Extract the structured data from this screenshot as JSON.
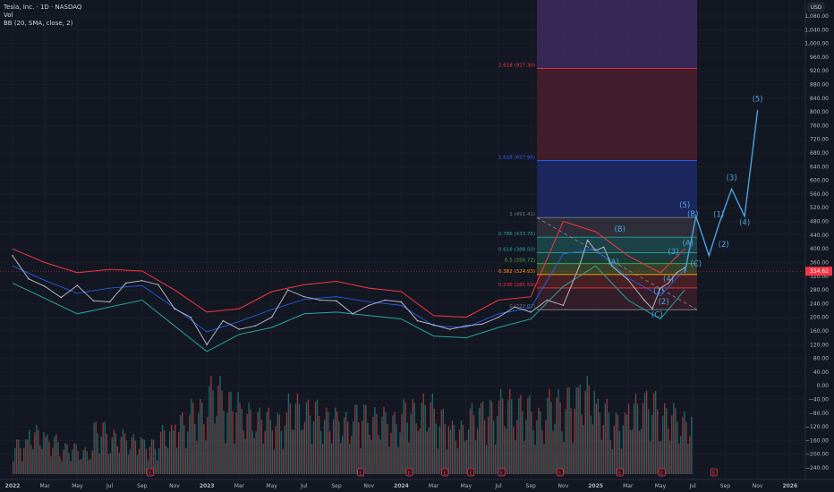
{
  "header": {
    "symbol_line": "Tesla, Inc. · 1D · NASDAQ",
    "vol_label": "Vol",
    "bb_label": "BB (20, SMA, close, 2)"
  },
  "currency_badge": "USD",
  "price_badge": "334.62",
  "colors": {
    "background": "#131722",
    "grid": "#1e222d",
    "price": "#b2b5be",
    "bb_upper": "#f23645",
    "bb_lower": "#26a69a",
    "bb_basis": "#2962ff",
    "wave": "#4aa3df",
    "vol_up": "#26a69a",
    "vol_down": "#ef5350"
  },
  "chart_data": {
    "type": "line",
    "title": "Tesla, Inc. · 1D · NASDAQ",
    "y_axis": {
      "ticks": [
        1080,
        1040,
        1000,
        960,
        920,
        880,
        840,
        800,
        760,
        720,
        680,
        640,
        600,
        560,
        520,
        480,
        440,
        400,
        360,
        320,
        280,
        240,
        200,
        160,
        120,
        80,
        40,
        0,
        -40,
        -80,
        -120,
        -160,
        -200,
        -240
      ],
      "tick_labels": [
        "1,080.00",
        "1,040.00",
        "1,000.00",
        "960.00",
        "920.00",
        "880.00",
        "840.00",
        "800.00",
        "760.00",
        "720.00",
        "680.00",
        "640.00",
        "600.00",
        "560.00",
        "520.00",
        "480.00",
        "440.00",
        "400.00",
        "360.00",
        "320.00",
        "280.00",
        "240.00",
        "200.00",
        "160.00",
        "120.00",
        "80.00",
        "40.00",
        "0.00",
        "−40.00",
        "−80.00",
        "−120.00",
        "−160.00",
        "−200.00",
        "−240.00"
      ]
    },
    "x_axis": {
      "ticks": [
        "2022",
        "Mar",
        "May",
        "Jul",
        "Sep",
        "Nov",
        "2023",
        "Mar",
        "May",
        "Jul",
        "Sep",
        "Nov",
        "2024",
        "Mar",
        "May",
        "Jul",
        "Sep",
        "Nov",
        "2025",
        "Mar",
        "May",
        "Jul",
        "Sep",
        "Nov",
        "2026"
      ],
      "tick_months": [
        0,
        2,
        4,
        6,
        8,
        10,
        12,
        14,
        16,
        18,
        20,
        22,
        24,
        26,
        28,
        30,
        32,
        34,
        36,
        38,
        40,
        42,
        44,
        46,
        48
      ]
    },
    "price_series": {
      "name": "TSLA",
      "months": [
        0,
        1,
        2,
        3,
        4,
        5,
        6,
        7,
        8,
        9,
        10,
        11,
        12,
        13,
        14,
        15,
        16,
        17,
        18,
        19,
        20,
        21,
        22,
        23,
        24,
        25,
        26,
        27,
        28,
        29,
        30,
        31,
        32,
        33,
        34,
        35,
        35.5,
        36,
        36.5,
        37,
        38,
        39,
        39.5,
        40,
        40.5,
        41,
        41.5
      ],
      "values": [
        380,
        312,
        290,
        258,
        293,
        248,
        245,
        300,
        307,
        295,
        225,
        200,
        120,
        190,
        165,
        175,
        200,
        280,
        260,
        250,
        248,
        210,
        235,
        250,
        245,
        190,
        178,
        165,
        175,
        180,
        200,
        230,
        215,
        250,
        235,
        350,
        425,
        395,
        405,
        350,
        310,
        250,
        225,
        285,
        300,
        330,
        345
      ]
    },
    "bb_upper": {
      "months": [
        0,
        2,
        4,
        6,
        8,
        10,
        12,
        14,
        16,
        18,
        20,
        22,
        24,
        26,
        28,
        30,
        32,
        34,
        36,
        38,
        40,
        41.5
      ],
      "values": [
        400,
        360,
        330,
        340,
        335,
        280,
        215,
        225,
        275,
        295,
        305,
        285,
        275,
        205,
        200,
        250,
        260,
        480,
        450,
        380,
        330,
        400
      ]
    },
    "bb_lower": {
      "months": [
        0,
        2,
        4,
        6,
        8,
        10,
        12,
        14,
        16,
        18,
        20,
        22,
        24,
        26,
        28,
        30,
        32,
        34,
        36,
        38,
        40,
        41.5
      ],
      "values": [
        300,
        255,
        210,
        230,
        250,
        175,
        100,
        150,
        170,
        210,
        215,
        205,
        195,
        145,
        140,
        170,
        195,
        290,
        350,
        250,
        195,
        280
      ]
    },
    "fib_levels": [
      {
        "ratio": "2.618",
        "price": 927.3,
        "label": "2.618 (927.30)",
        "color": "#f23645",
        "fill": "#4a1e2e"
      },
      {
        "ratio": "1.618",
        "price": 657.9,
        "label": "1.618 (657.90)",
        "color": "#2962ff",
        "fill": "#1d2a66"
      },
      {
        "ratio": "1",
        "price": 491.41,
        "label": "1 (491.41)",
        "color": "#787b86",
        "fill": "#33333d"
      },
      {
        "ratio": "0.786",
        "price": 433.76,
        "label": "0.786 (433.76)",
        "color": "#26a69a",
        "fill": "#1f4a4d"
      },
      {
        "ratio": "0.618",
        "price": 388.5,
        "label": "0.618 (388.50)",
        "color": "#26a69a",
        "fill": "#1e4140"
      },
      {
        "ratio": "0.5",
        "price": 356.72,
        "label": "0.5 (356.72)",
        "color": "#4caf50",
        "fill": "#3b4a2a"
      },
      {
        "ratio": "0.382",
        "price": 324.93,
        "label": "0.382 (324.93)",
        "color": "#ff9800",
        "fill": "#4d2226"
      },
      {
        "ratio": "0.236",
        "price": 285.59,
        "label": "0.236 (285.59)",
        "color": "#f23645",
        "fill": "#3a1f2a"
      },
      {
        "ratio": "0",
        "price": 222.02,
        "label": "0 (222.02)",
        "color": "#787b86",
        "fill": ""
      }
    ],
    "fib_top_fill": {
      "color": "#3e2a5e"
    },
    "elliott_projection": {
      "months": [
        41.5,
        42.2,
        43.0,
        43.6,
        44.4,
        45.2,
        46.0
      ],
      "values": [
        330,
        495,
        380,
        470,
        575,
        495,
        805
      ]
    },
    "wave_labels": [
      {
        "text": "(5)",
        "month": 46.0,
        "value": 830
      },
      {
        "text": "(3)",
        "month": 44.4,
        "value": 600
      },
      {
        "text": "(4)",
        "month": 45.2,
        "value": 470
      },
      {
        "text": "(1)",
        "month": 43.6,
        "value": 493
      },
      {
        "text": "(2)",
        "month": 43.9,
        "value": 405
      },
      {
        "text": "(5)",
        "month": 41.5,
        "value": 520
      },
      {
        "text": "(B)",
        "month": 42.0,
        "value": 495
      },
      {
        "text": "(A)",
        "month": 41.7,
        "value": 410
      },
      {
        "text": "(C)",
        "month": 42.2,
        "value": 350
      },
      {
        "text": "(B)",
        "month": 37.5,
        "value": 450
      },
      {
        "text": "(A)",
        "month": 37.1,
        "value": 355
      },
      {
        "text": "(C)",
        "month": 39.8,
        "value": 200
      },
      {
        "text": "(2)",
        "month": 40.2,
        "value": 238
      },
      {
        "text": "(1)",
        "month": 39.9,
        "value": 270
      },
      {
        "text": "(3)",
        "month": 40.8,
        "value": 385
      },
      {
        "text": "(4)",
        "month": 40.5,
        "value": 305
      }
    ],
    "volume": {
      "months": [
        0,
        1,
        2,
        3,
        4,
        5,
        6,
        7,
        8,
        9,
        10,
        11,
        12,
        13,
        14,
        15,
        16,
        17,
        18,
        19,
        20,
        21,
        22,
        23,
        24,
        25,
        26,
        27,
        28,
        29,
        30,
        31,
        32,
        33,
        34,
        35,
        36,
        37,
        38,
        39,
        40,
        41
      ],
      "values": [
        40,
        55,
        45,
        35,
        30,
        60,
        50,
        45,
        40,
        55,
        70,
        85,
        110,
        95,
        80,
        75,
        70,
        90,
        85,
        75,
        70,
        80,
        75,
        70,
        85,
        90,
        75,
        60,
        80,
        85,
        95,
        90,
        75,
        95,
        100,
        110,
        85,
        70,
        90,
        95,
        80,
        70
      ]
    },
    "event_markers": [
      {
        "letter": "E",
        "month": 8.5
      },
      {
        "letter": "E",
        "month": 21.5
      },
      {
        "letter": "E",
        "month": 24.5
      },
      {
        "letter": "E",
        "month": 26.7
      },
      {
        "letter": "E",
        "month": 28.3
      },
      {
        "letter": "E",
        "month": 30.2
      },
      {
        "letter": "E",
        "month": 33.8
      },
      {
        "letter": "E",
        "month": 37.5
      },
      {
        "letter": "E",
        "month": 40.1
      },
      {
        "letter": "E",
        "month": 43.3
      }
    ]
  }
}
